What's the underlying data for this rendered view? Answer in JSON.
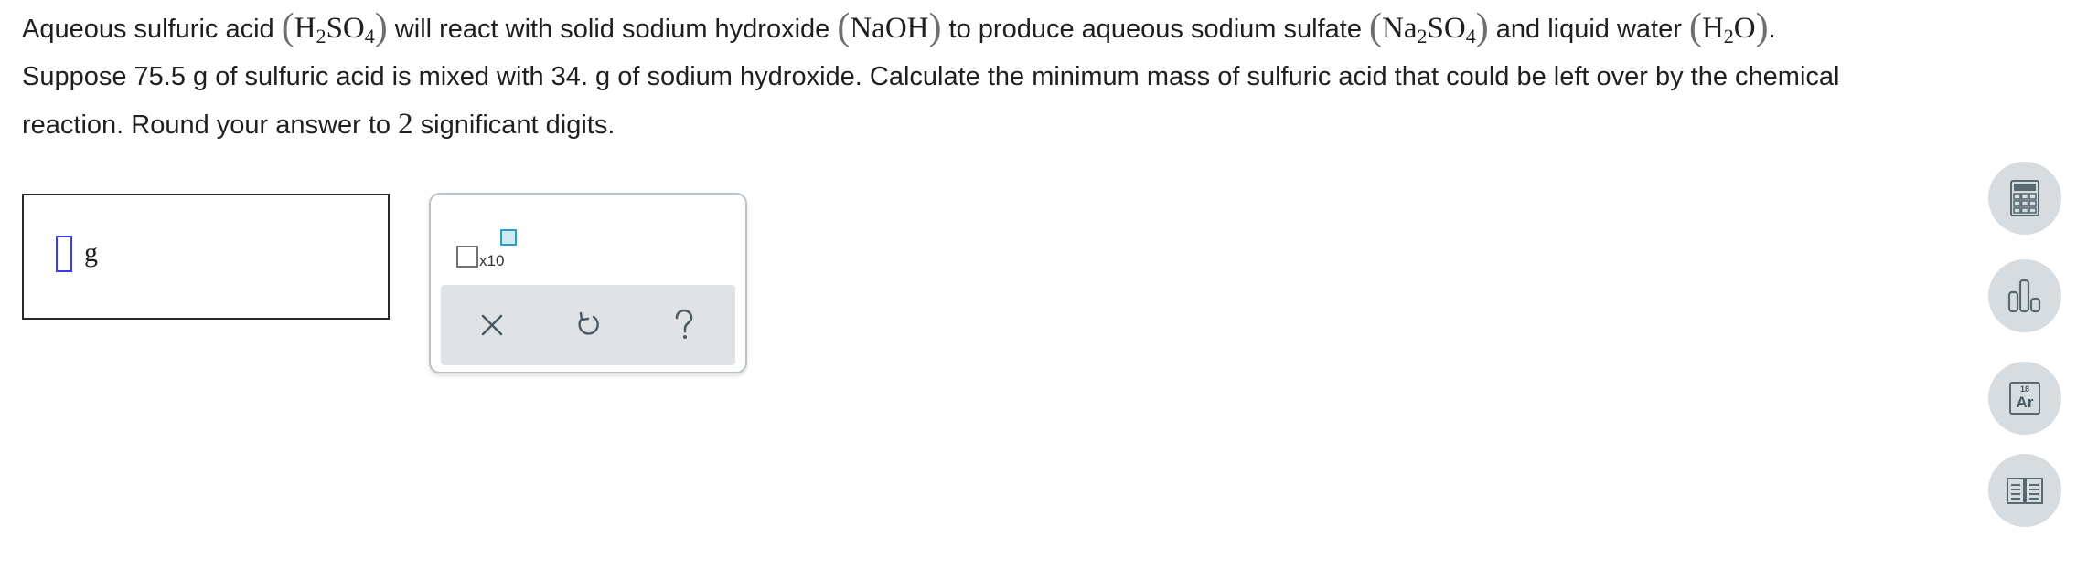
{
  "question": {
    "line1": {
      "t1": "Aqueous sulfuric acid ",
      "f1": [
        "H",
        "2",
        "SO",
        "4"
      ],
      "t2": " will react with solid sodium hydroxide ",
      "f2": "NaOH",
      "t3": " to produce aqueous sodium sulfate ",
      "f3": [
        "Na",
        "2",
        "SO",
        "4"
      ],
      "t4": " and liquid water ",
      "f4": [
        "H",
        "2",
        "O"
      ],
      "t5": "."
    },
    "line2": "Suppose 75.5 g of sulfuric acid is mixed with 34. g of sodium hydroxide. Calculate the minimum mass of sulfuric acid that could be left over by the chemical",
    "line3": {
      "t1": "reaction. Round your answer to ",
      "digits": "2",
      "t2": " significant digits."
    }
  },
  "answer": {
    "value": "",
    "unit": "g"
  },
  "toolbox": {
    "sci_notation_label": "x10",
    "buttons": [
      "clear-icon",
      "undo-icon",
      "help-icon"
    ]
  },
  "side_tools": {
    "calculator": "calculator-icon",
    "chart": "bar-chart-icon",
    "periodic": {
      "number": "18",
      "symbol": "Ar"
    },
    "reference": "book-icon"
  },
  "colors": {
    "accent_blue": "#3b3bf2",
    "sci_box": "#2a9ec4",
    "side_bg": "#d6dcdf",
    "icon_gray": "#596a73"
  }
}
